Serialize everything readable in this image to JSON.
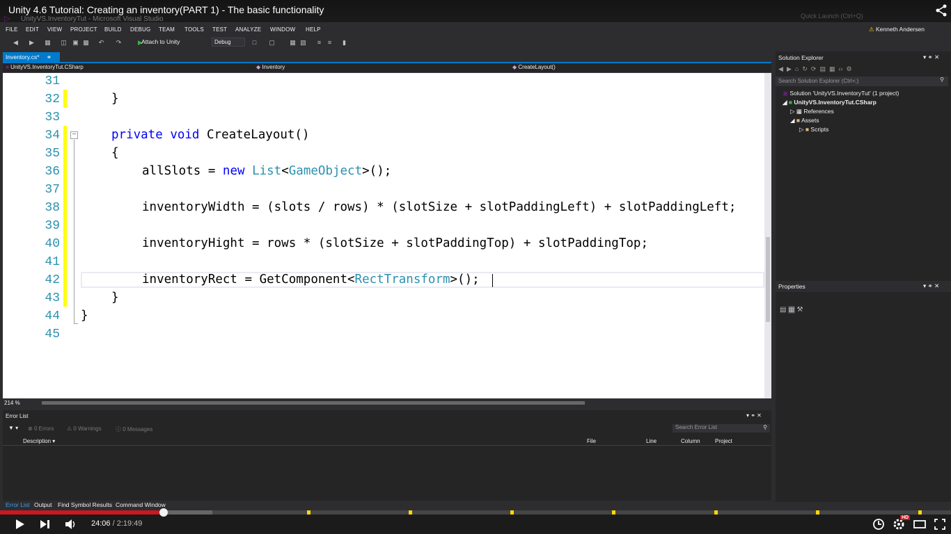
{
  "video": {
    "title": "Unity 4.6 Tutorial: Creating an inventory(PART 1) - The basic functionality",
    "current_time": "24:06",
    "duration": "/ 2:19:49",
    "progress_fraction": 0.172,
    "hd_badge": "HD"
  },
  "ide": {
    "app_hint": "UnityVS.InventoryTut - Microsoft Visual Studio",
    "quick_launch": "Quick Launch (Ctrl+Q)",
    "menu": [
      "FILE",
      "EDIT",
      "VIEW",
      "PROJECT",
      "BUILD",
      "DEBUG",
      "TEAM",
      "TOOLS",
      "TEST",
      "ANALYZE",
      "WINDOW",
      "HELP"
    ],
    "user": "Kenneth Andersen",
    "toolbar": {
      "attach": "Attach to Unity",
      "config": "Debug"
    },
    "tab": "Inventory.cs*",
    "nav": {
      "project": "UnityVS.InventoryTut.CSharp",
      "class": "Inventory",
      "member": "CreateLayout()"
    },
    "zoom": "214 %"
  },
  "code": {
    "line_numbers": [
      "31",
      "32",
      "33",
      "34",
      "35",
      "36",
      "37",
      "38",
      "39",
      "40",
      "41",
      "42",
      "43",
      "44",
      "45"
    ],
    "line32": "}",
    "line34": {
      "kw1": "private",
      "kw2": "void",
      "rest": " CreateLayout()"
    },
    "line35": "{",
    "line36": {
      "a": "allSlots = ",
      "kw": "new",
      "b": " ",
      "t1": "List",
      "c": "<",
      "t2": "GameObject",
      "d": ">();"
    },
    "line38": "inventoryWidth = (slots / rows) * (slotSize + slotPaddingLeft) + slotPaddingLeft;",
    "line40": "inventoryHight = rows * (slotSize + slotPaddingTop) + slotPaddingTop;",
    "line42": {
      "a": "inventoryRect = GetComponent<",
      "t": "RectTransform",
      "b": ">();"
    },
    "line43": "}",
    "line44": "}"
  },
  "solution_explorer": {
    "title": "Solution Explorer",
    "search": "Search Solution Explorer (Ctrl+;)",
    "items": [
      "Solution 'UnityVS.InventoryTut' (1 project)",
      "UnityVS.InventoryTut.CSharp",
      "References",
      "Assets",
      "Scripts"
    ]
  },
  "properties": {
    "title": "Properties"
  },
  "error_list": {
    "title": "Error List",
    "errors": "0 Errors",
    "warnings": "0 Warnings",
    "messages": "0 Messages",
    "search": "Search Error List",
    "columns": [
      "Description",
      "File",
      "Line",
      "Column",
      "Project"
    ]
  },
  "bottom_tabs": [
    "Error List",
    "Output",
    "Find Symbol Results",
    "Command Window"
  ],
  "colors": {
    "accent": "#007acc",
    "progress": "#cc181e",
    "marker": "#ffd700",
    "keyword": "#0000ff",
    "type": "#2b91af"
  }
}
